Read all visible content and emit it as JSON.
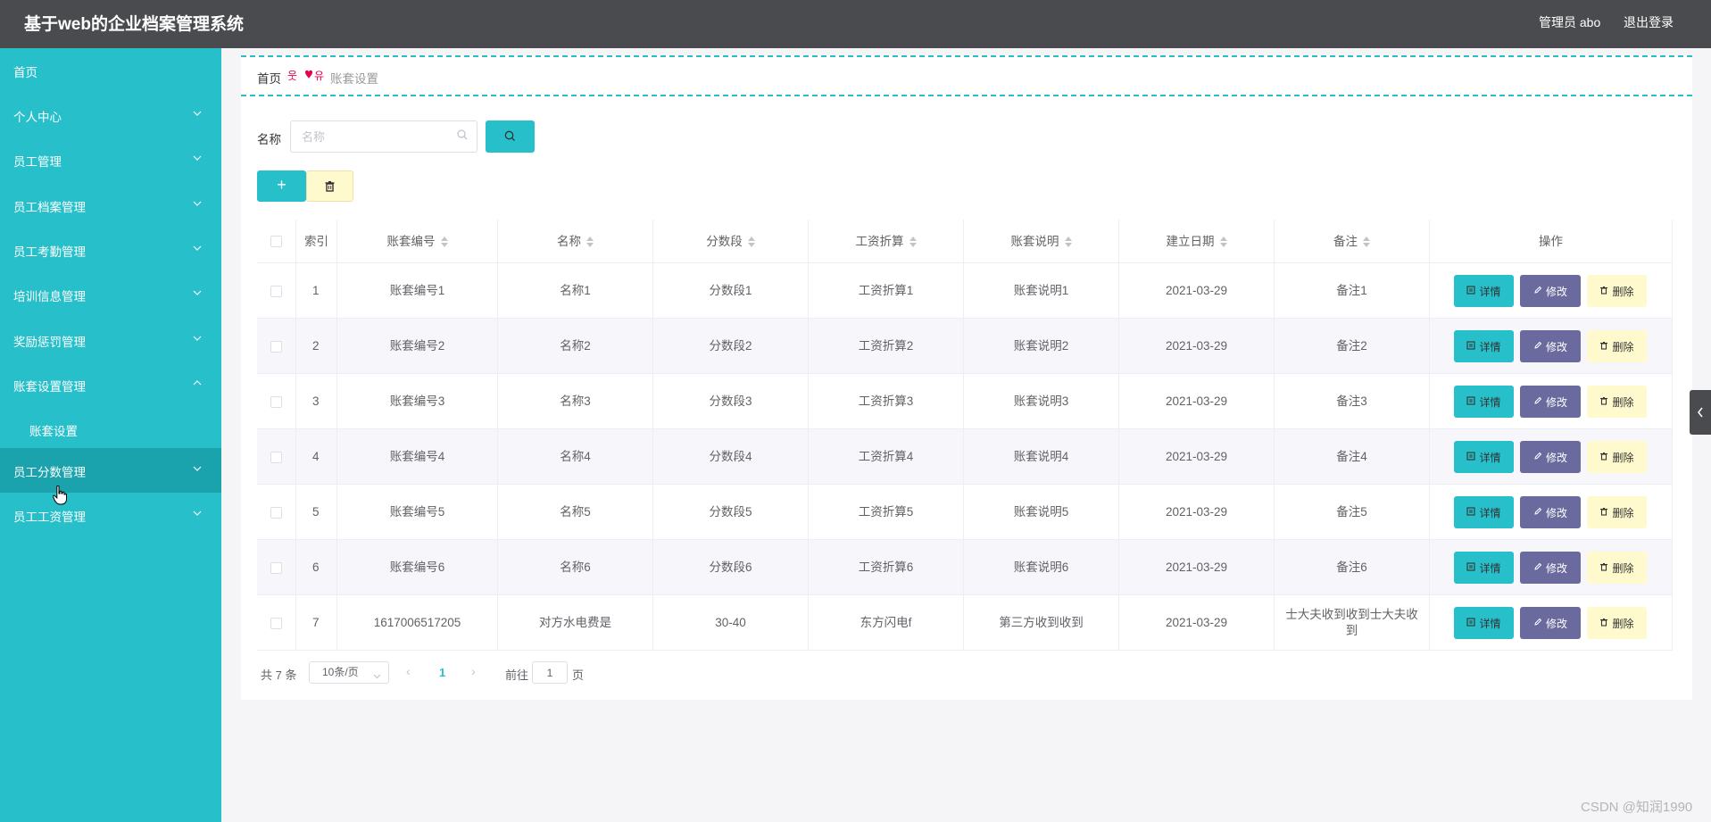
{
  "header": {
    "title": "基于web的企业档案管理系统",
    "user": "管理员 abo",
    "logout": "退出登录"
  },
  "sidebar": {
    "items": [
      {
        "label": "首页",
        "chevron": "none"
      },
      {
        "label": "个人中心",
        "chevron": "down"
      },
      {
        "label": "员工管理",
        "chevron": "down"
      },
      {
        "label": "员工档案管理",
        "chevron": "down"
      },
      {
        "label": "员工考勤管理",
        "chevron": "down"
      },
      {
        "label": "培训信息管理",
        "chevron": "down"
      },
      {
        "label": "奖励惩罚管理",
        "chevron": "down"
      },
      {
        "label": "账套设置管理",
        "chevron": "up"
      },
      {
        "label": "账套设置",
        "chevron": "none",
        "sub": true
      },
      {
        "label": "员工分数管理",
        "chevron": "down",
        "active": true
      },
      {
        "label": "员工工资管理",
        "chevron": "down"
      }
    ]
  },
  "breadcrumb": {
    "home": "首页",
    "separator": "everyone-heart",
    "current": "账套设置"
  },
  "search": {
    "label": "名称",
    "placeholder": "名称",
    "value": ""
  },
  "toolbar": {
    "add_label": "+",
    "delete_icon": "trash-icon"
  },
  "table": {
    "headers": [
      "索引",
      "账套编号",
      "名称",
      "分数段",
      "工资折算",
      "账套说明",
      "建立日期",
      "备注",
      "操作"
    ],
    "actions": {
      "detail": "详情",
      "edit": "修改",
      "delete": "删除"
    },
    "rows": [
      {
        "index": "1",
        "code": "账套编号1",
        "name": "名称1",
        "score": "分数段1",
        "salary": "工资折算1",
        "desc": "账套说明1",
        "date": "2021-03-29",
        "note": "备注1"
      },
      {
        "index": "2",
        "code": "账套编号2",
        "name": "名称2",
        "score": "分数段2",
        "salary": "工资折算2",
        "desc": "账套说明2",
        "date": "2021-03-29",
        "note": "备注2"
      },
      {
        "index": "3",
        "code": "账套编号3",
        "name": "名称3",
        "score": "分数段3",
        "salary": "工资折算3",
        "desc": "账套说明3",
        "date": "2021-03-29",
        "note": "备注3"
      },
      {
        "index": "4",
        "code": "账套编号4",
        "name": "名称4",
        "score": "分数段4",
        "salary": "工资折算4",
        "desc": "账套说明4",
        "date": "2021-03-29",
        "note": "备注4"
      },
      {
        "index": "5",
        "code": "账套编号5",
        "name": "名称5",
        "score": "分数段5",
        "salary": "工资折算5",
        "desc": "账套说明5",
        "date": "2021-03-29",
        "note": "备注5"
      },
      {
        "index": "6",
        "code": "账套编号6",
        "name": "名称6",
        "score": "分数段6",
        "salary": "工资折算6",
        "desc": "账套说明6",
        "date": "2021-03-29",
        "note": "备注6"
      },
      {
        "index": "7",
        "code": "1617006517205",
        "name": "对方水电费是",
        "score": "30-40",
        "salary": "东方闪电f",
        "desc": "第三方收到收到",
        "date": "2021-03-29",
        "note": "士大夫收到收到士大夫收到"
      }
    ]
  },
  "pagination": {
    "total": "共 7 条",
    "page_size": "10条/页",
    "current": "1",
    "goto_label": "前往",
    "goto_value": "1",
    "page_suffix": "页"
  },
  "watermark": "CSDN @知润1990",
  "colors": {
    "header": "#4a4b4f",
    "sidebar": "#26bfca",
    "sidebar_active": "#1aa3ad",
    "accent": "#26bfca",
    "edit": "#6a6a9e",
    "warning_bg": "#fffacd"
  }
}
